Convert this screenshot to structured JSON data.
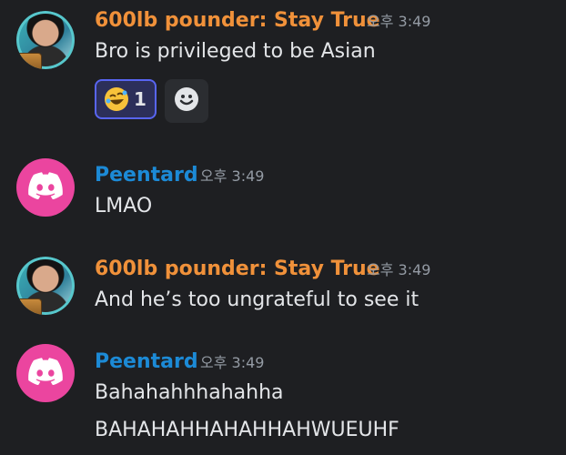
{
  "colors": {
    "background": "#1e1f22",
    "author_orange": "#f0913a",
    "author_blue": "#1c8ad6",
    "discord_pink": "#eb459f",
    "reaction_border": "#5865f2"
  },
  "messages": [
    {
      "author": "600lb pounder: Stay True",
      "timestamp": "오후 3:49",
      "lines": [
        "Bro is privileged to be Asian"
      ],
      "avatar": "profile-photo",
      "reaction": {
        "emoji": "rolling-on-floor-laughing-icon",
        "count": "1"
      }
    },
    {
      "author": "Peentard",
      "timestamp": "오후 3:49",
      "lines": [
        "LMAO"
      ],
      "avatar": "discord-logo-icon"
    },
    {
      "author": "600lb pounder: Stay True",
      "timestamp": "오후 3:49",
      "lines": [
        "And he’s too ungrateful to see it"
      ],
      "avatar": "profile-photo"
    },
    {
      "author": "Peentard",
      "timestamp": "오후 3:49",
      "lines": [
        "Bahahahhhahahha",
        "BAHAHAHHAHAHHAHWUEUHF"
      ],
      "avatar": "discord-logo-icon"
    }
  ],
  "icons": {
    "add_reaction": "smiley-face-icon"
  }
}
